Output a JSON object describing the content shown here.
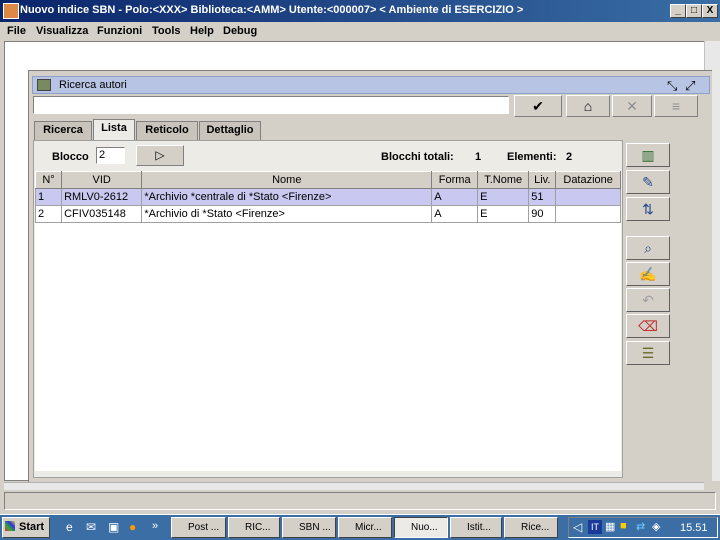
{
  "window": {
    "title": "Nuovo indice SBN - Polo:<XXX> Biblioteca:<AMM> Utente:<000007>       < Ambiente di ESERCIZIO >",
    "controls": [
      "_",
      "□",
      "X"
    ]
  },
  "menu": [
    "File",
    "Visualizza",
    "Funzioni",
    "Tools",
    "Help",
    "Debug"
  ],
  "frame": {
    "title": "Ricerca autori",
    "toolbar_icons": [
      "refresh-check-icon",
      "home-icon",
      "close-icon",
      "list-icon"
    ]
  },
  "tabs": [
    "Ricerca",
    "Lista",
    "Reticolo",
    "Dettaglio"
  ],
  "active_tab": "Lista",
  "blocco": {
    "label": "Blocco",
    "value": "2"
  },
  "summary": {
    "blocchi_label": "Blocchi totali:",
    "blocchi_value": "1",
    "elementi_label": "Elementi:",
    "elementi_value": "2"
  },
  "table": {
    "headers": [
      "N°",
      "VID",
      "Nome",
      "Forma",
      "T.Nome",
      "Liv.",
      "Datazione"
    ],
    "rows": [
      [
        "1",
        "RMLV0-2612",
        "*Archivio *centrale di *Stato <Firenze>",
        "A",
        "E",
        "51",
        ""
      ],
      [
        "2",
        "CFIV035148",
        "*Archivio di *Stato <Firenze>",
        "A",
        "E",
        "90",
        ""
      ]
    ]
  },
  "side_buttons": [
    "books-icon",
    "edit-down-icon",
    "sort-icon",
    "search-doc-icon",
    "edit-doc-icon",
    "undo-icon",
    "eraser-icon",
    "stack-icon"
  ],
  "taskbar": {
    "start": "Start",
    "tasks": [
      "Post ...",
      "RIC...",
      "SBN ...",
      "Micr...",
      "Nuo...",
      "Istit...",
      "Rice..."
    ],
    "active_task": "Nuo...",
    "lang": "IT",
    "clock": "15.51"
  }
}
